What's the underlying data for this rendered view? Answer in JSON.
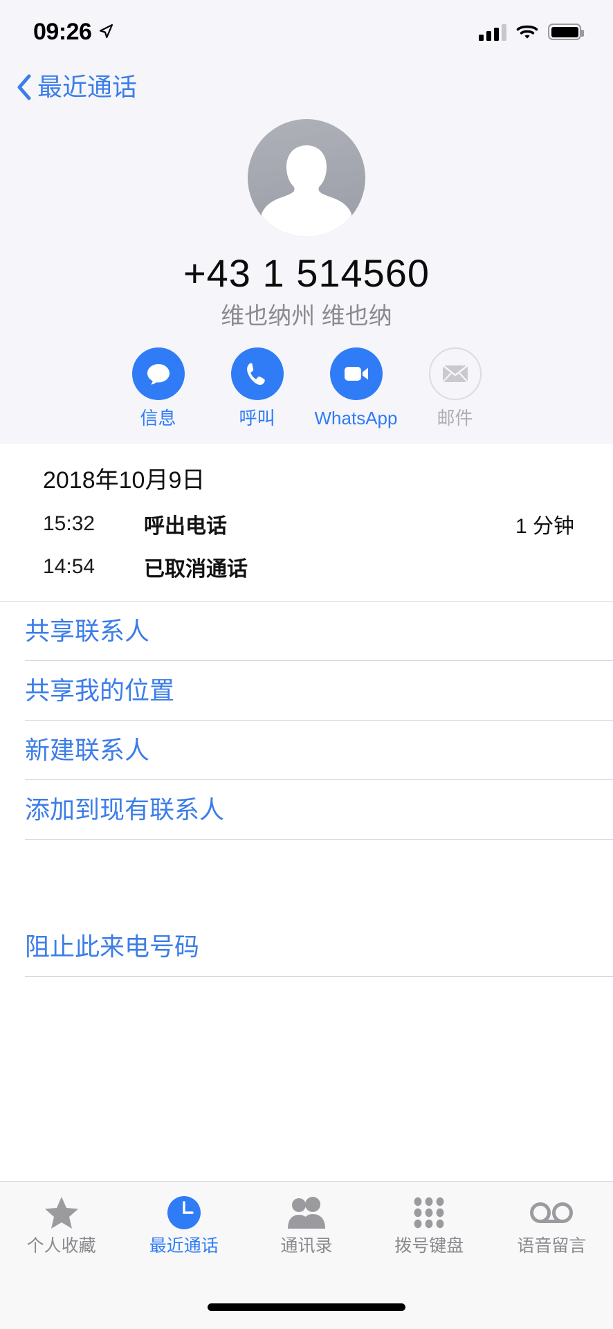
{
  "status_bar": {
    "time": "09:26",
    "location_icon": "location-arrow-icon",
    "signal_icon": "cellular-signal-icon",
    "signal_bars_filled": 3,
    "signal_bars_total": 4,
    "wifi_icon": "wifi-icon",
    "battery_icon": "battery-icon",
    "battery_level_percent": 88
  },
  "nav": {
    "back_icon": "chevron-left-icon",
    "back_label": "最近通话"
  },
  "contact": {
    "avatar_icon": "person-placeholder-icon",
    "phone_number": "+43 1 514560",
    "location": "维也纳州 维也纳"
  },
  "actions": [
    {
      "label": "信息",
      "icon": "message-bubble-icon",
      "disabled": false
    },
    {
      "label": "呼叫",
      "icon": "phone-handset-icon",
      "disabled": false
    },
    {
      "label": "WhatsApp",
      "icon": "video-camera-icon",
      "disabled": false
    },
    {
      "label": "邮件",
      "icon": "envelope-icon",
      "disabled": true
    }
  ],
  "call_history": {
    "date": "2018年10月9日",
    "rows": [
      {
        "time": "15:32",
        "type": "呼出电话",
        "duration": "1 分钟"
      },
      {
        "time": "14:54",
        "type": "已取消通话",
        "duration": ""
      }
    ]
  },
  "list_actions": [
    {
      "label": "共享联系人"
    },
    {
      "label": "共享我的位置"
    },
    {
      "label": "新建联系人"
    },
    {
      "label": "添加到现有联系人"
    }
  ],
  "block_action": {
    "label": "阻止此来电号码"
  },
  "tabs": [
    {
      "label": "个人收藏",
      "icon": "star-icon",
      "active": false
    },
    {
      "label": "最近通话",
      "icon": "clock-icon",
      "active": true
    },
    {
      "label": "通讯录",
      "icon": "contacts-people-icon",
      "active": false
    },
    {
      "label": "拨号键盘",
      "icon": "keypad-dots-icon",
      "active": false
    },
    {
      "label": "语音留言",
      "icon": "voicemail-icon",
      "active": false
    }
  ],
  "colors": {
    "accent_blue": "#2F7CF6",
    "link_blue": "#3C7DE8",
    "header_bg": "#F5F5FA",
    "inactive_gray": "#8A8A8F",
    "separator": "#D2D2D5"
  },
  "home_indicator": "home-indicator-bar"
}
